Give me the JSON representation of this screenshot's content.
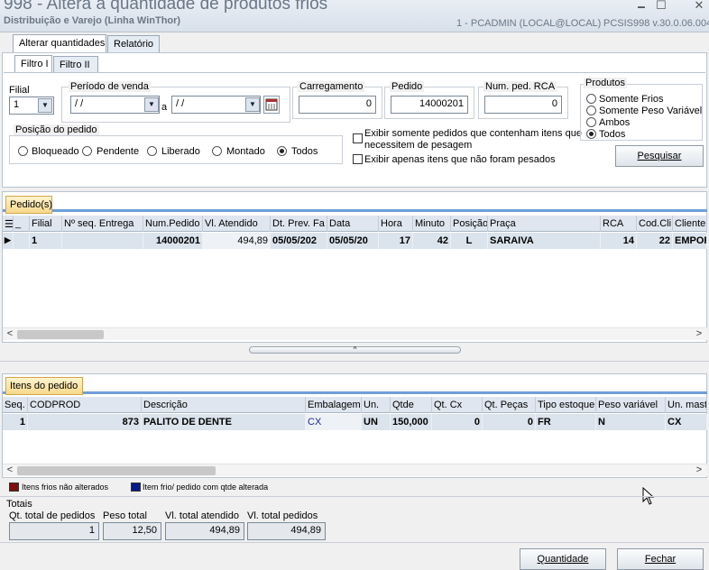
{
  "window": {
    "title": "998 - Altera a quantidade de produtos frios",
    "subtitle": "Distribuição e Varejo (Linha WinThor)",
    "user": "1 - PCADMIN (LOCAL@LOCAL)",
    "version": "PCSIS998  v.30.0.06.004",
    "btn_min": "🗕",
    "btn_max": "☐",
    "btn_close": "✕"
  },
  "tabs": {
    "main": [
      "Alterar quantidades",
      "Relatório"
    ],
    "sub": [
      "Filtro I",
      "Filtro II"
    ]
  },
  "filters": {
    "filial_label": "Filial",
    "filial_value": "1",
    "periodo_label": "Período de venda",
    "date_from": "/ /",
    "date_sep": "a",
    "date_to": "/ /",
    "carregamento_label": "Carregamento",
    "carregamento_value": "0",
    "pedido_label": "Pedido",
    "pedido_value": "14000201",
    "num_rca_label": "Num. ped. RCA",
    "num_rca_value": "0",
    "posicao_label": "Posição do pedido",
    "posicao_options": [
      "Bloqueado",
      "Pendente",
      "Liberado",
      "Montado",
      "Todos"
    ],
    "posicao_selected": "Todos",
    "check1_line1": "Exibir somente pedidos que contenham itens que",
    "check1_line2": "necessitem  de pesagem",
    "check2": "Exibir apenas itens que não foram pesados",
    "produtos_label": "Produtos",
    "produtos_options": [
      "Somente Frios",
      "Somente Peso Variável",
      "Ambos",
      "Todos"
    ],
    "produtos_selected": "Todos",
    "pesquisar": "Pesquisar"
  },
  "pedidos": {
    "tab_label": "Pedido(s)",
    "columns": [
      "_",
      "Filial",
      "Nº seq. Entrega",
      "Num.Pedido",
      "Vl. Atendido",
      "Dt. Prev. Fa",
      "Data",
      "Hora",
      "Minuto",
      "Posição",
      "Praça",
      "RCA",
      "Cod.Cli",
      "Cliente"
    ],
    "rows": [
      [
        "",
        "1",
        "",
        "14000201",
        "494,89",
        "05/05/202",
        "05/05/20",
        "17",
        "42",
        "L",
        "SARAIVA",
        "14",
        "22",
        "EMPOR"
      ]
    ]
  },
  "itens": {
    "tab_label": "Itens do pedido",
    "columns": [
      "Seq.",
      "CODPROD",
      "Descrição",
      "Embalagem",
      "Un.",
      "Qtde",
      "Qt. Cx",
      "Qt. Peças",
      "Tipo estoque",
      "Peso variável",
      "Un. maste"
    ],
    "rows": [
      [
        "1",
        "873",
        "PALITO DE DENTE",
        "CX",
        "UN",
        "150,000",
        "0",
        "0",
        "FR",
        "N",
        "CX"
      ]
    ]
  },
  "legend": {
    "item1": "Itens frios não alterados",
    "item1_color": "#7a1010",
    "item2": "Item frio/ pedido com qtde alterada",
    "item2_color": "#0a1a8a"
  },
  "totais": {
    "label": "Totais",
    "fields": [
      {
        "label": "Qt. total de pedidos",
        "value": "1"
      },
      {
        "label": "Peso total",
        "value": "12,50"
      },
      {
        "label": "Vl. total atendido",
        "value": "494,89"
      },
      {
        "label": "Vl. total pedidos",
        "value": "494,89"
      }
    ]
  },
  "footer": {
    "quantidade": "Quantidade",
    "fechar": "Fechar"
  }
}
